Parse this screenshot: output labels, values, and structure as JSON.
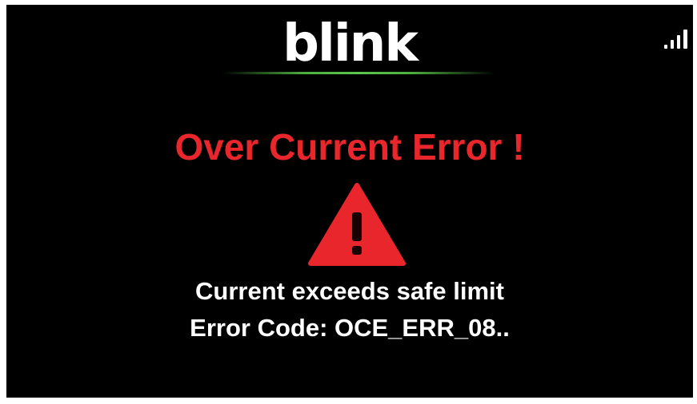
{
  "brand": {
    "logo_text": "blink",
    "accent_color": "#4caf3f"
  },
  "status": {
    "signal_icon": "signal-strength-icon"
  },
  "error": {
    "title": "Over Current Error !",
    "title_color": "#e8262b",
    "icon": "warning-triangle-icon",
    "message": "Current exceeds safe limit",
    "code_line": "Error Code: OCE_ERR_08.."
  }
}
